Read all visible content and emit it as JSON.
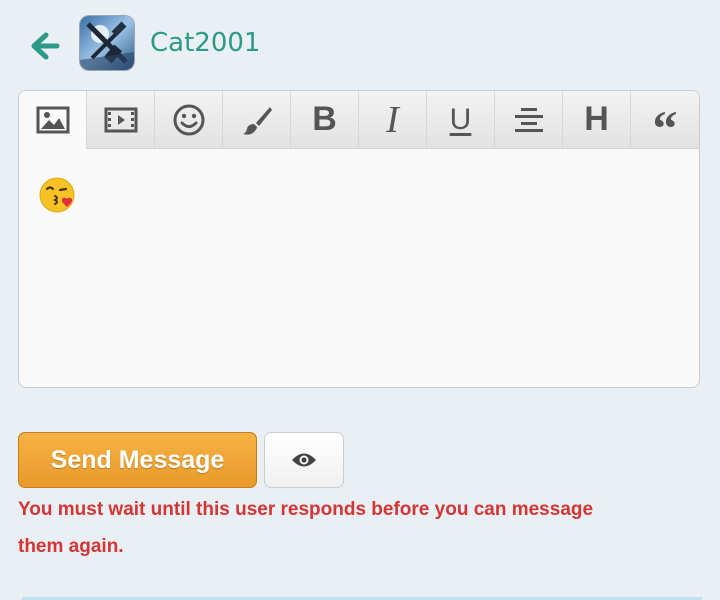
{
  "header": {
    "back_icon": "arrow-left-icon",
    "username": "Cat2001"
  },
  "toolbar": {
    "items": [
      {
        "name": "image",
        "icon": "image-icon"
      },
      {
        "name": "video",
        "icon": "film-icon"
      },
      {
        "name": "emoji",
        "icon": "smiley-icon"
      },
      {
        "name": "color",
        "icon": "brush-icon"
      },
      {
        "name": "bold",
        "label": "B"
      },
      {
        "name": "italic",
        "label": "I"
      },
      {
        "name": "underline",
        "label": "U"
      },
      {
        "name": "align",
        "icon": "align-center-icon"
      },
      {
        "name": "heading",
        "label": "H"
      },
      {
        "name": "quote",
        "label": "“"
      }
    ]
  },
  "editor": {
    "content_emoji": "face-blowing-a-kiss"
  },
  "actions": {
    "send_label": "Send Message",
    "preview_icon": "eye-icon"
  },
  "error": {
    "line1": "You must wait until this user responds before you can message",
    "line2": "them again."
  },
  "colors": {
    "accent": "#2b9a88",
    "send_button": "#f0a535",
    "error": "#d43535",
    "background": "#eaeff3"
  }
}
